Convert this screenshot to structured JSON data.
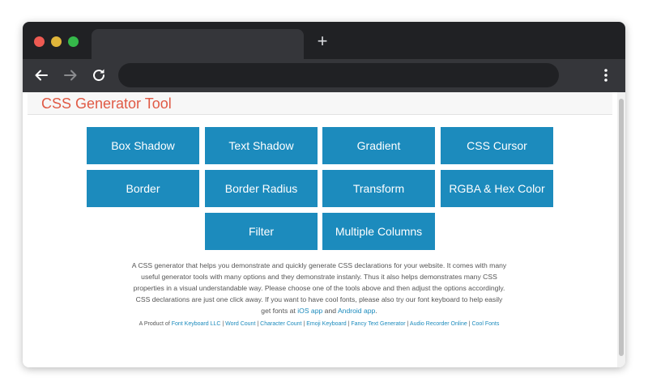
{
  "browser": {
    "new_tab_label": "+"
  },
  "page": {
    "title": "CSS Generator Tool"
  },
  "tools": [
    "Box Shadow",
    "Text Shadow",
    "Gradient",
    "CSS Cursor",
    "Border",
    "Border Radius",
    "Transform",
    "RGBA & Hex Color",
    "Filter",
    "Multiple Columns"
  ],
  "description": {
    "text": "A CSS generator that helps you demonstrate and quickly generate CSS declarations for your website. It comes with many useful generator tools with many options and they demonstrate instanly. Thus it also helps demonstrates many CSS properties in a visual understandable way. Please choose one of the tools above and then adjust the options accordingly. CSS declarations are just one click away. If you want to have cool fonts, please also try our font keyboard to help easily get fonts at",
    "ios_link": "iOS app",
    "and": "and",
    "android_link": "Android app",
    "end": "."
  },
  "footer": {
    "prefix": "A Product of",
    "links": [
      "Font Keyboard LLC",
      "Word Count",
      "Character Count",
      "Emoji Keyboard",
      "Fancy Text Generator",
      "Audio Recorder Online",
      "Cool Fonts"
    ],
    "separator": "|"
  },
  "colors": {
    "button_bg": "#1c8bbd",
    "title_color": "#e05a45",
    "link_color": "#1c8bbd"
  }
}
